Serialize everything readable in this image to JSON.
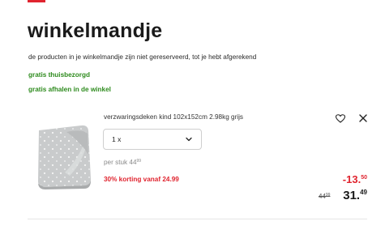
{
  "header": {
    "title": "winkelmandje",
    "brand_color": "#e0242f"
  },
  "intro_text": "de producten in je winkelmandje zijn niet gereserveerd, tot je hebt afgerekend",
  "services": [
    {
      "label": "gratis thuisbezorgd"
    },
    {
      "label": "gratis afhalen in de winkel"
    }
  ],
  "cart": {
    "items": [
      {
        "name": "verzwaringsdeken kind 102x152cm 2.98kg grijs",
        "image_icon": "grey-star-blanket-image",
        "quantity": {
          "selected": "1 x"
        },
        "unit_price": {
          "prefix": "per stuk",
          "whole": "44",
          "fraction": "99"
        },
        "discount_label": "30% korting vanaf 24.99",
        "discount_amount": {
          "whole": "-13.",
          "fraction": "50"
        },
        "old_price": {
          "whole": "44",
          "fraction": "99"
        },
        "new_price": {
          "whole": "31.",
          "fraction": "49"
        },
        "actions": {
          "favorite_icon": "heart-icon",
          "remove_icon": "close-icon"
        }
      }
    ]
  },
  "colors": {
    "green": "#2e8b1e",
    "red": "#e0242f"
  }
}
